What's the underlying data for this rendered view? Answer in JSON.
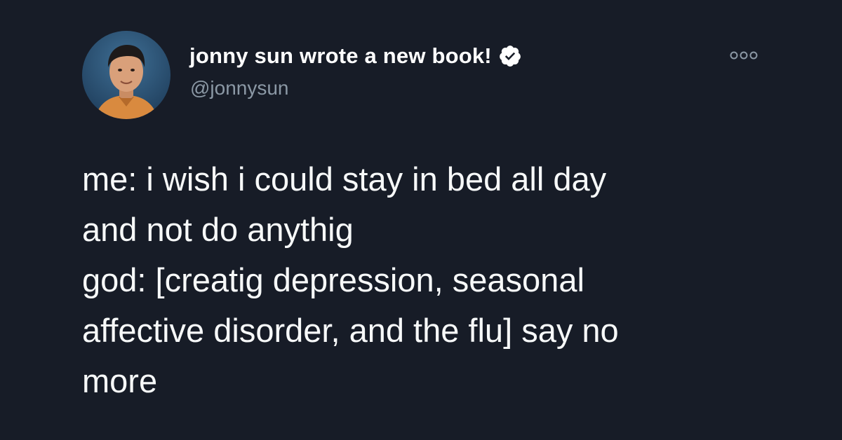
{
  "tweet": {
    "author": {
      "display_name": "jonny sun wrote a new book!",
      "handle": "@jonnysun",
      "verified": true,
      "avatar_icon": "profile-photo"
    },
    "more_icon": "more-options-icon",
    "text_lines": [
      "me: i wish i could stay in bed all day",
      "and not do anythig",
      "god: [creatig depression, seasonal",
      "affective disorder, and the flu] say no",
      "more"
    ]
  },
  "colors": {
    "background": "#171c27",
    "text_primary": "#f7f9f9",
    "text_secondary": "#8b98a5",
    "verified_badge": "#ffffff"
  }
}
